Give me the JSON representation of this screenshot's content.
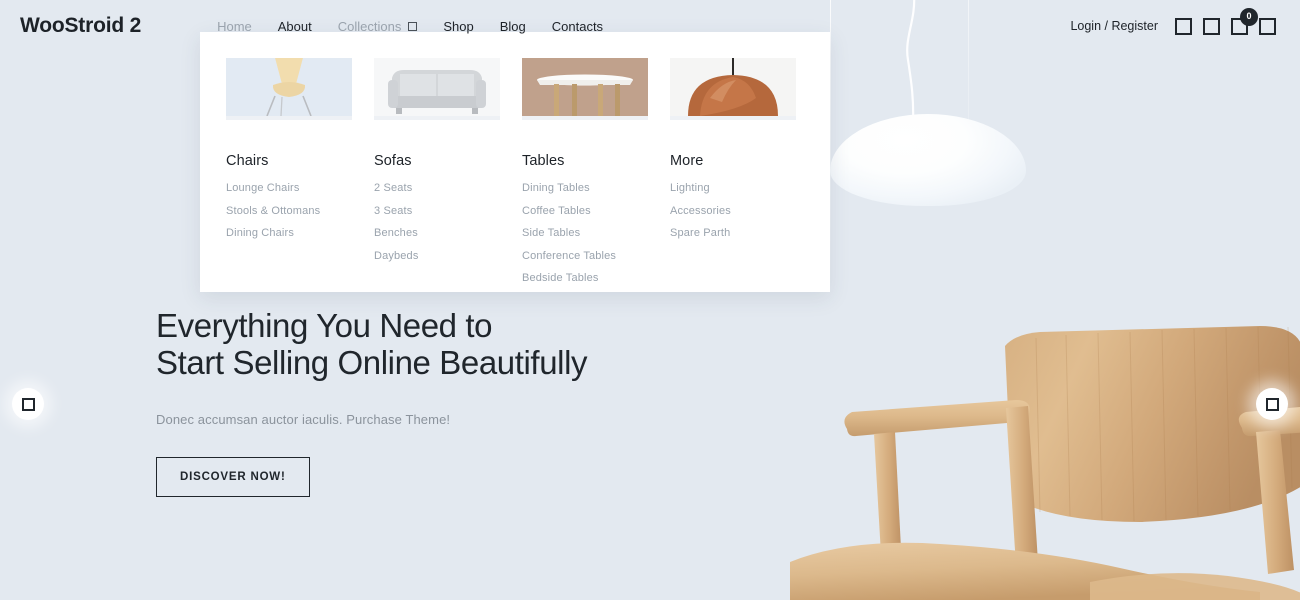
{
  "header": {
    "logo": "WooStroid 2",
    "nav": [
      {
        "label": "Home",
        "muted": true,
        "has_caret": false
      },
      {
        "label": "About",
        "muted": false,
        "has_caret": false
      },
      {
        "label": "Collections",
        "muted": true,
        "has_caret": true
      },
      {
        "label": "Shop",
        "muted": false,
        "has_caret": false
      },
      {
        "label": "Blog",
        "muted": false,
        "has_caret": false
      },
      {
        "label": "Contacts",
        "muted": false,
        "has_caret": false
      }
    ],
    "account_link": "Login / Register",
    "icons": [
      {
        "name": "search-icon"
      },
      {
        "name": "wishlist-icon"
      },
      {
        "name": "cart-icon"
      },
      {
        "name": "menu-icon"
      }
    ],
    "cart_count": "0"
  },
  "mega_menu": {
    "columns": [
      {
        "title": "Chairs",
        "thumb_name": "chairs-thumbnail",
        "links": [
          "Lounge Chairs",
          "Stools & Ottomans",
          "Dining Chairs"
        ]
      },
      {
        "title": "Sofas",
        "thumb_name": "sofas-thumbnail",
        "links": [
          "2 Seats",
          "3 Seats",
          "Benches",
          "Daybeds"
        ]
      },
      {
        "title": "Tables",
        "thumb_name": "tables-thumbnail",
        "links": [
          "Dining Tables",
          "Coffee Tables",
          "Side Tables",
          "Conference Tables",
          "Bedside Tables"
        ]
      },
      {
        "title": "More",
        "thumb_name": "more-thumbnail",
        "links": [
          "Lighting",
          "Accessories",
          "Spare Parth"
        ]
      }
    ]
  },
  "hero": {
    "heading_line1": "Everything You Need to",
    "heading_line2": "Start Selling Online Beautifully",
    "subtitle": "Donec accumsan auctor iaculis. Purchase Theme!",
    "cta_label": "DISCOVER NOW!"
  },
  "slider": {
    "prev_label": "",
    "next_label": ""
  },
  "colors": {
    "background": "#e3e9f0",
    "text_dark": "#20262c",
    "text_muted": "#9aa3ad",
    "panel": "#ffffff"
  }
}
